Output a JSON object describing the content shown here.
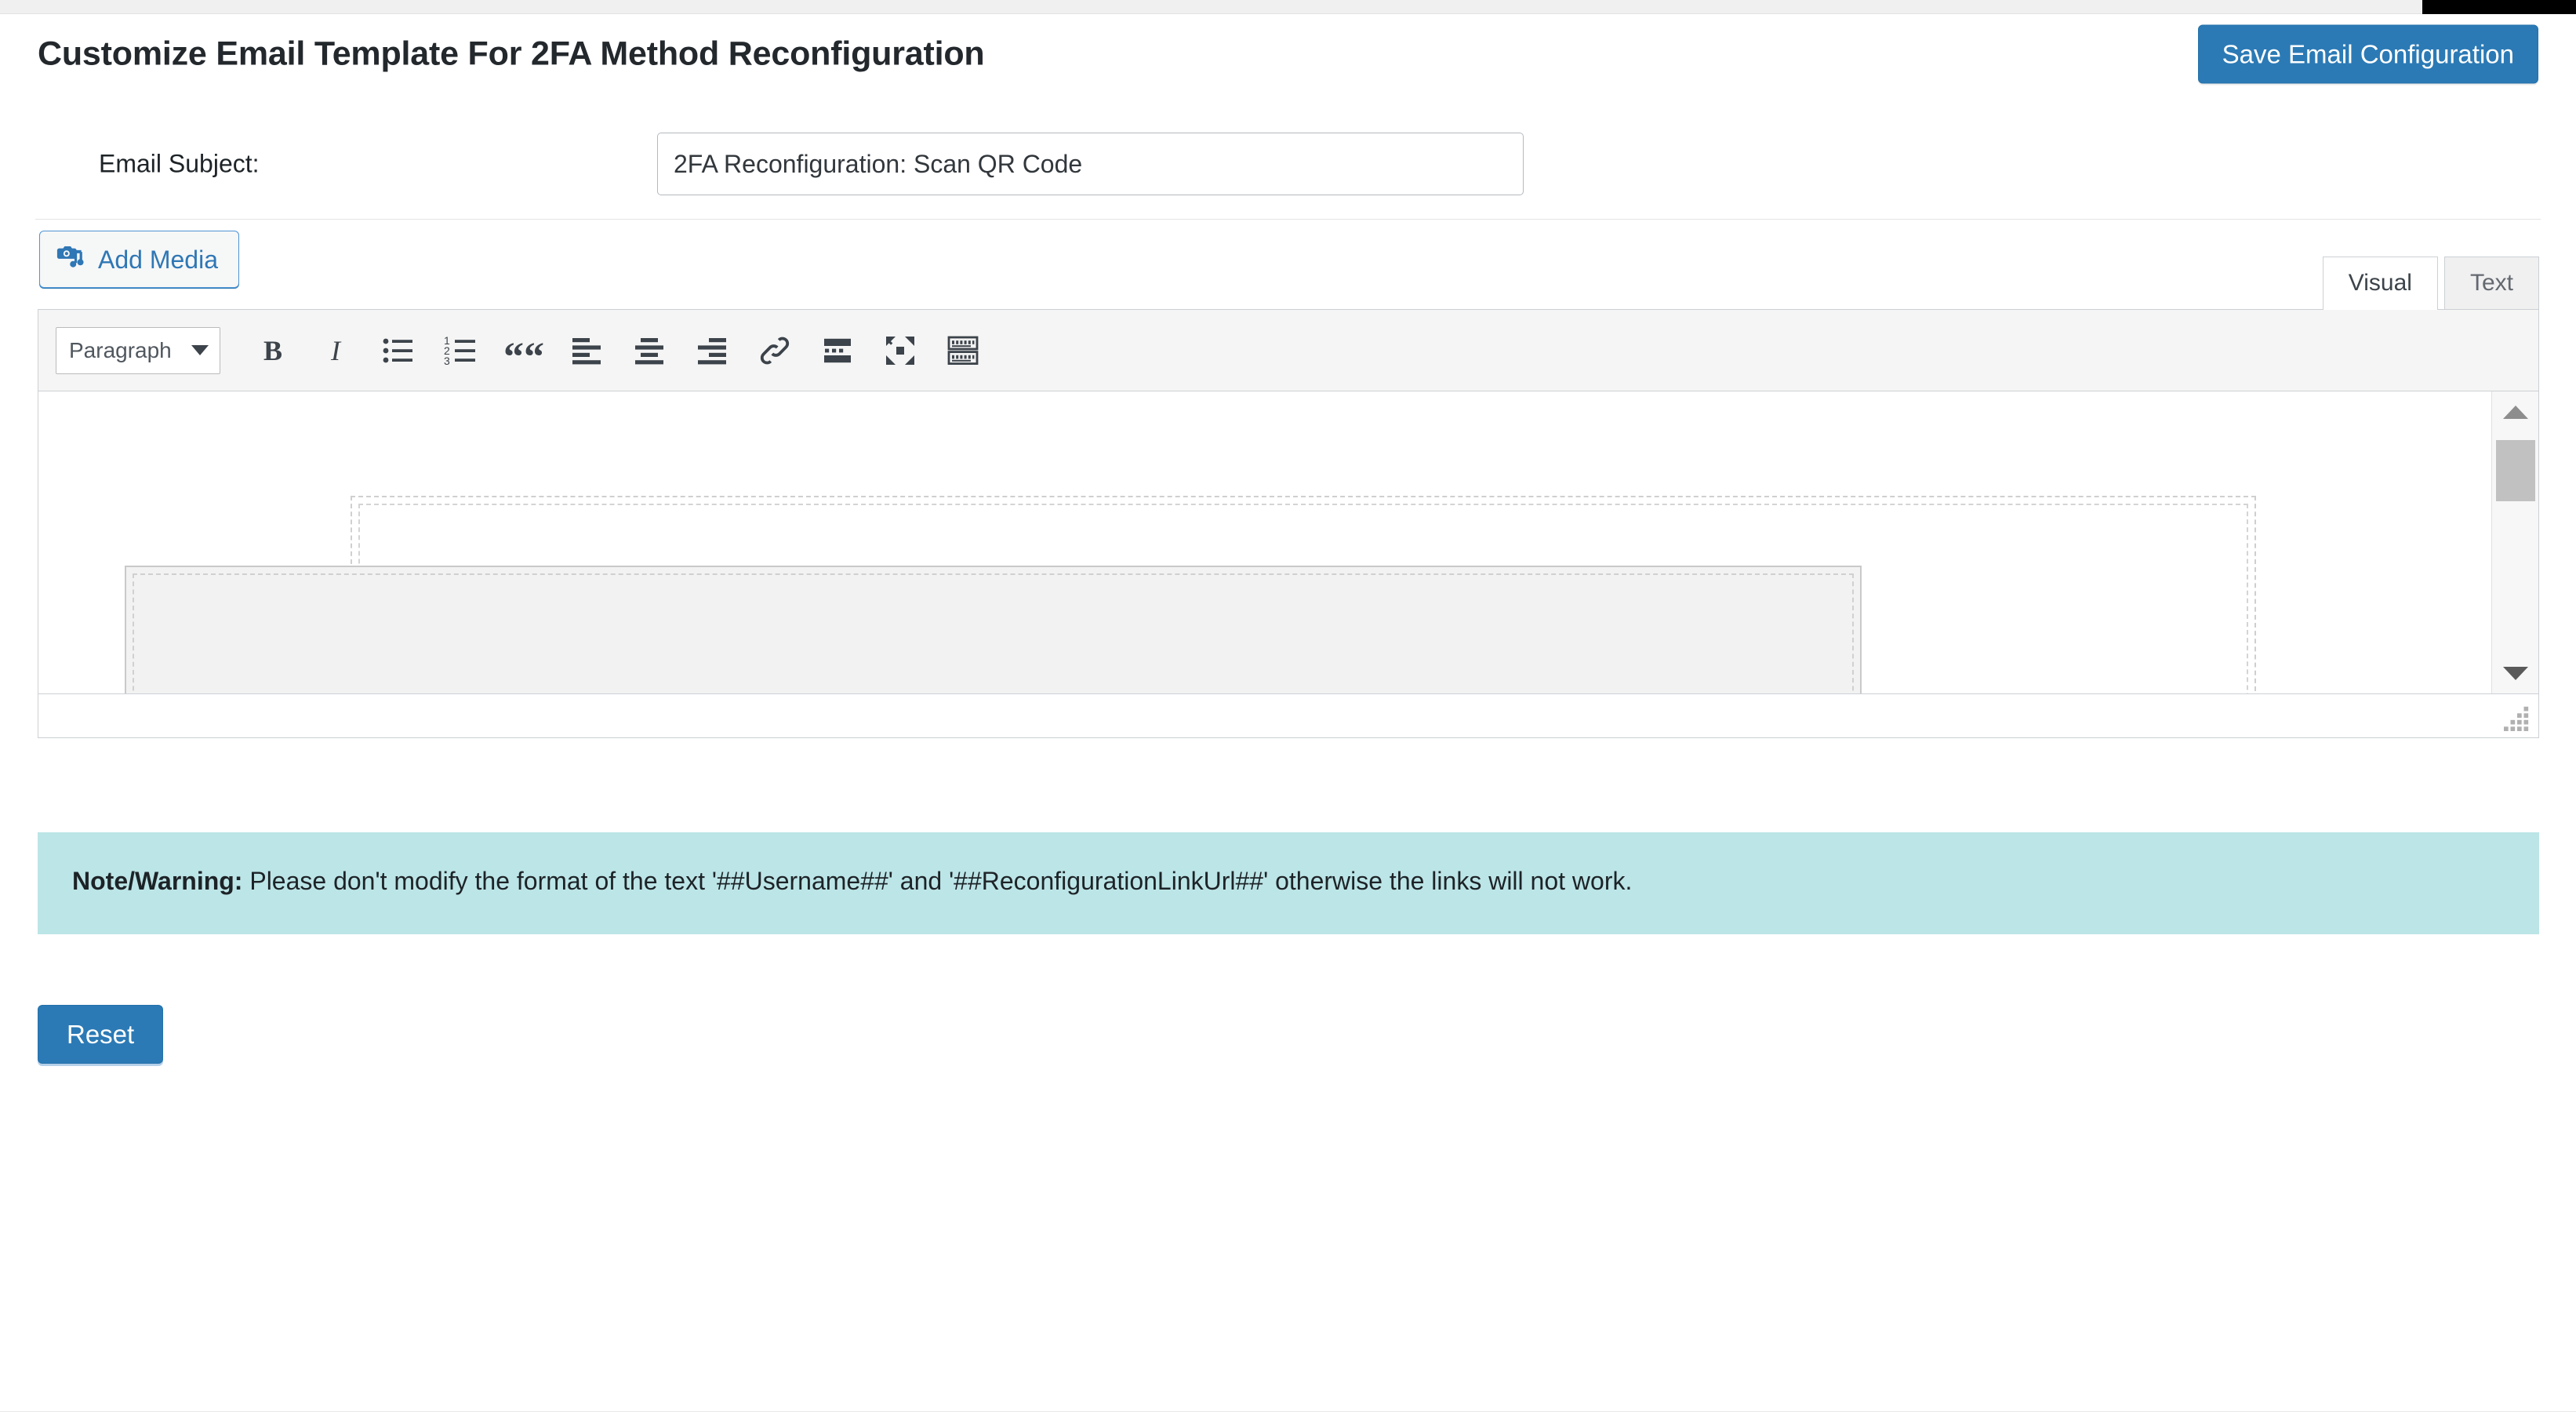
{
  "window": {
    "top_strip_color": "#f0f0f0",
    "corner_marker_color": "#000000"
  },
  "header": {
    "title": "Customize Email Template For 2FA Method Reconfiguration",
    "save_button_label": "Save Email Configuration",
    "accent_color": "#2b7ab5"
  },
  "subject": {
    "label": "Email Subject:",
    "value": "2FA Reconfiguration: Scan QR Code",
    "placeholder": ""
  },
  "editor": {
    "add_media_label": "Add Media",
    "add_media_icon": "media-camera-note-icon",
    "tabs": [
      {
        "label": "Visual",
        "active": true
      },
      {
        "label": "Text",
        "active": false
      }
    ],
    "toolbar": {
      "format_select_value": "Paragraph",
      "buttons": [
        {
          "name": "bold",
          "glyph": "B",
          "title": "Bold"
        },
        {
          "name": "italic",
          "glyph": "I",
          "title": "Italic"
        },
        {
          "name": "bulleted-list",
          "glyph": "",
          "title": "Bulleted list"
        },
        {
          "name": "numbered-list",
          "glyph": "",
          "title": "Numbered list"
        },
        {
          "name": "blockquote",
          "glyph": "““",
          "title": "Blockquote"
        },
        {
          "name": "align-left",
          "glyph": "",
          "title": "Align left"
        },
        {
          "name": "align-center",
          "glyph": "",
          "title": "Align center"
        },
        {
          "name": "align-right",
          "glyph": "",
          "title": "Align right"
        },
        {
          "name": "insert-link",
          "glyph": "",
          "title": "Insert/edit link"
        },
        {
          "name": "read-more",
          "glyph": "",
          "title": "Insert Read More tag"
        },
        {
          "name": "fullscreen",
          "glyph": "",
          "title": "Distraction-free writing mode"
        },
        {
          "name": "toolbar-toggle",
          "glyph": "",
          "title": "Toolbar Toggle"
        }
      ]
    },
    "content_body": "",
    "scrollbar": {
      "position": "near-top"
    }
  },
  "note": {
    "prefix": "Note/Warning:",
    "text": " Please don't modify the format of the text '##Username##' and '##ReconfigurationLinkUrl##' otherwise the links will not work.",
    "background_color": "#bce5e7"
  },
  "footer": {
    "reset_label": "Reset"
  }
}
